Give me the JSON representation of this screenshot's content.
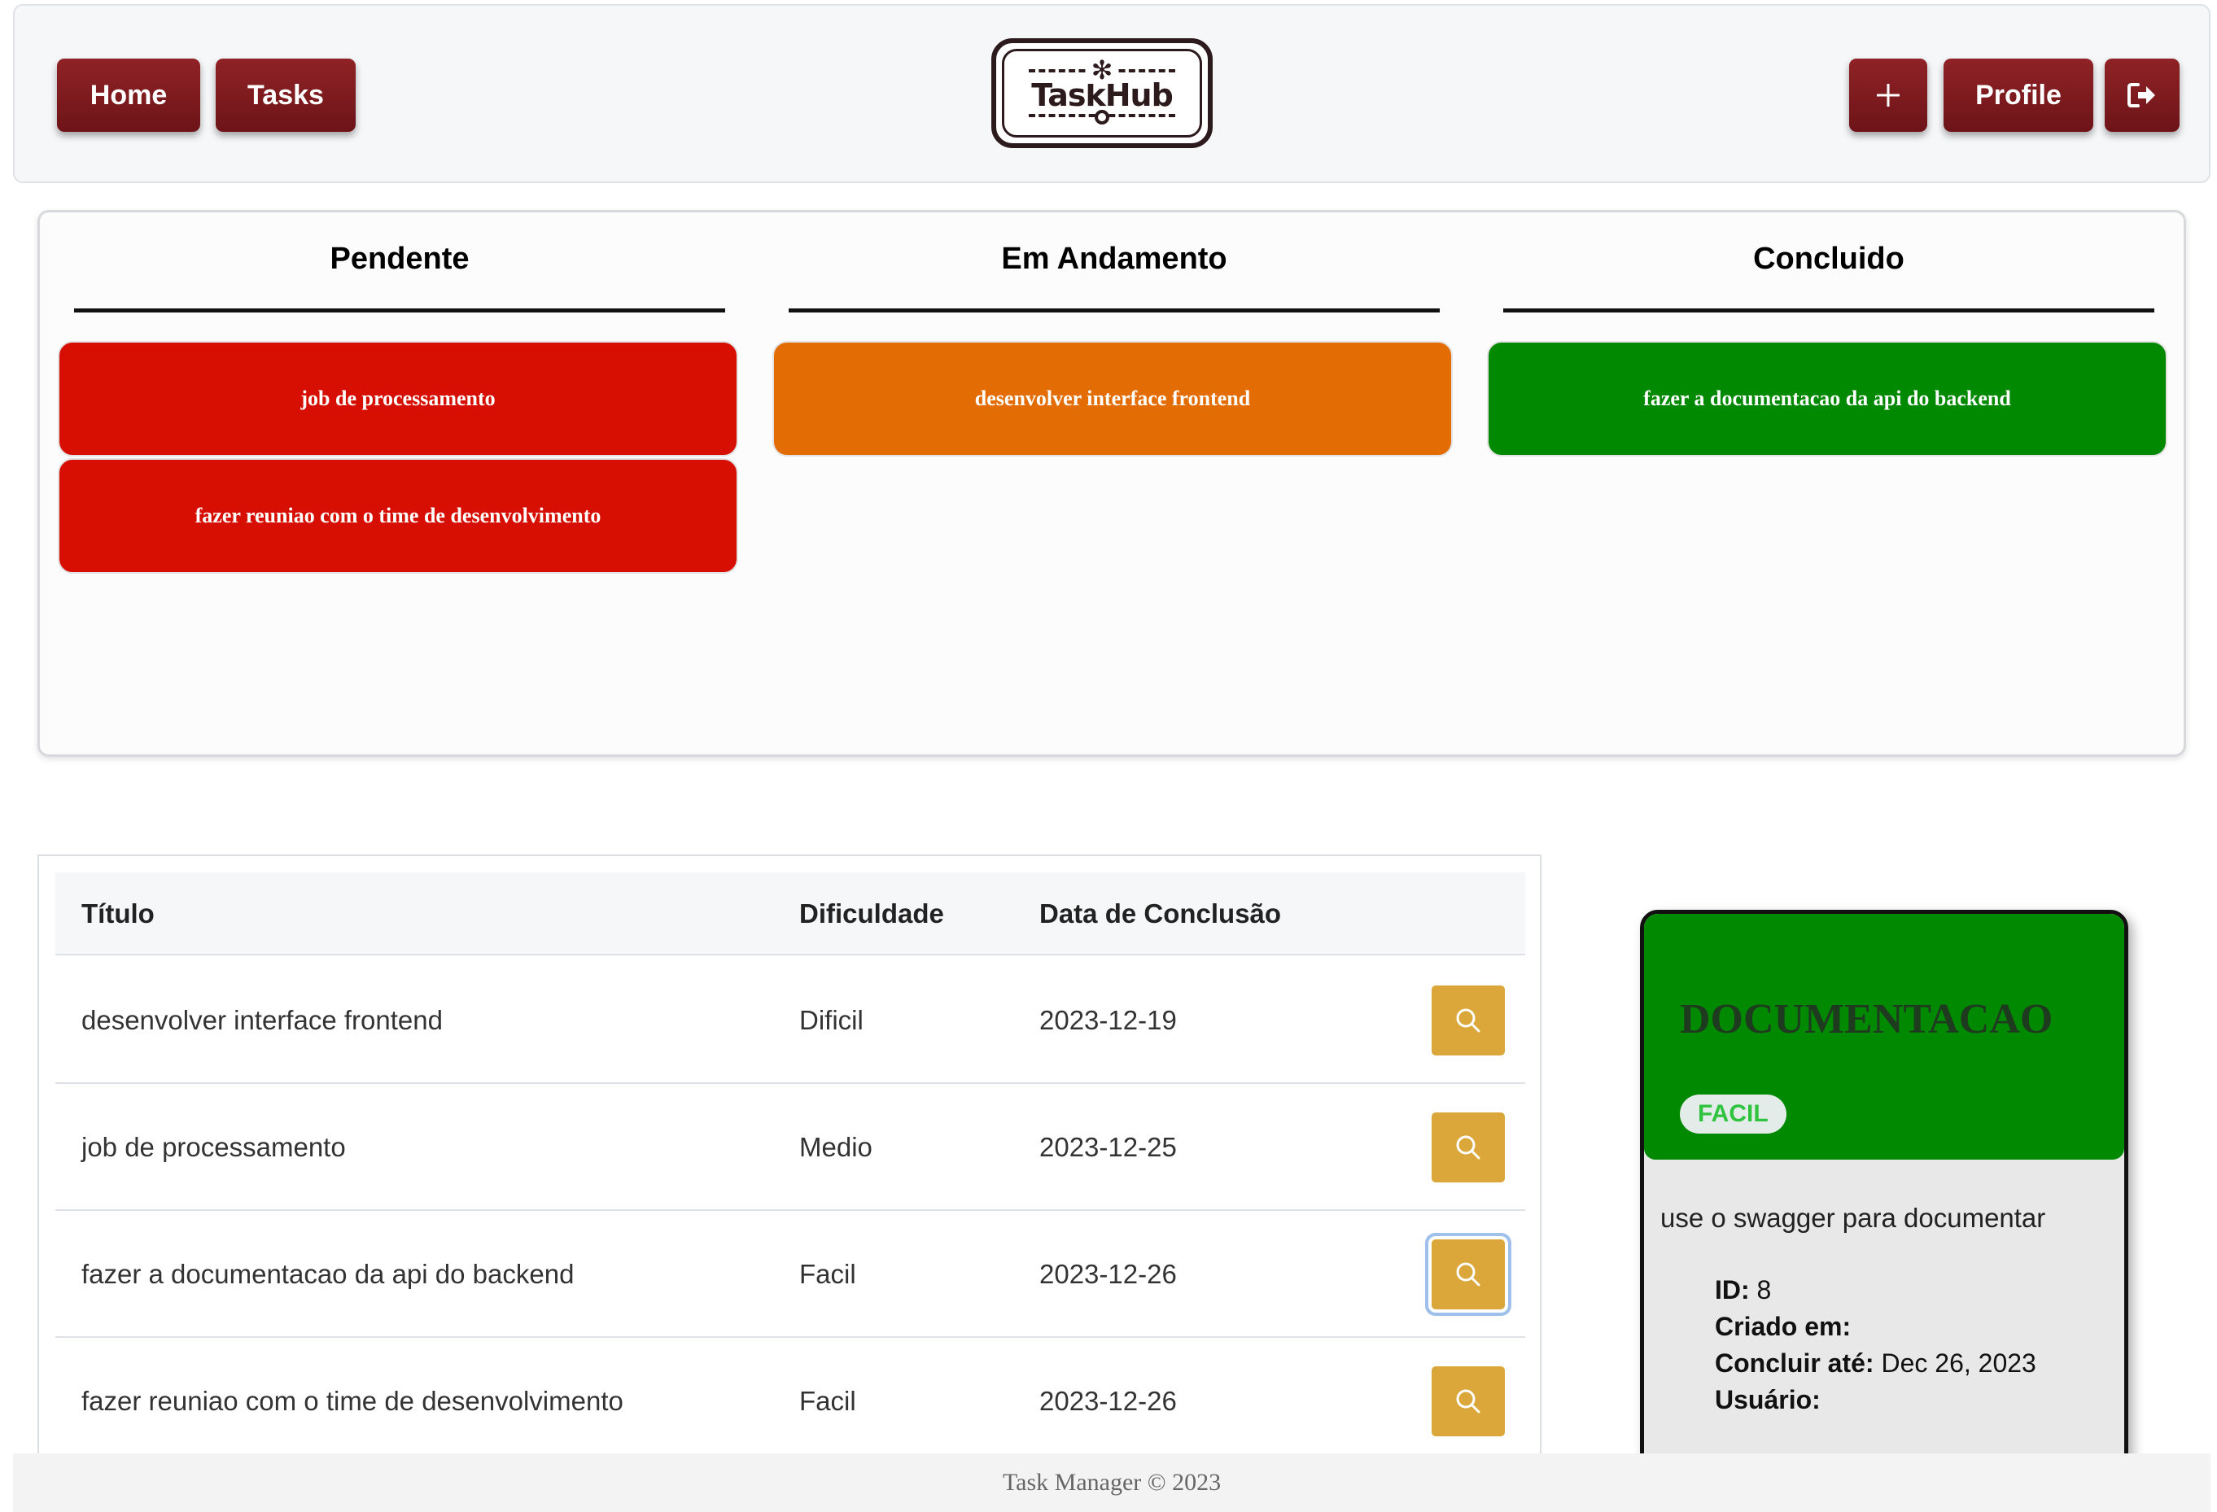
{
  "navbar": {
    "home_label": "Home",
    "tasks_label": "Tasks",
    "logo_text": "TaskHub",
    "add_icon": "plus-icon",
    "profile_label": "Profile",
    "logout_icon": "sign-out-icon",
    "button_color": "#7f1b1f"
  },
  "board": {
    "columns": [
      {
        "title": "Pendente",
        "cards": [
          "job de processamento",
          "fazer reuniao com o time de desenvolvimento"
        ],
        "color": "#d70f02"
      },
      {
        "title": "Em Andamento",
        "cards": [
          "desenvolver interface frontend"
        ],
        "color": "#e36c04"
      },
      {
        "title": "Concluido",
        "cards": [
          "fazer a documentacao da api do backend"
        ],
        "color": "#018a01"
      }
    ]
  },
  "table": {
    "headers": [
      "Título",
      "Dificuldade",
      "Data de Conclusão"
    ],
    "rows": [
      {
        "titulo": "desenvolver interface frontend",
        "dificuldade": "Dificil",
        "data": "2023-12-19"
      },
      {
        "titulo": "job de processamento",
        "dificuldade": "Medio",
        "data": "2023-12-25"
      },
      {
        "titulo": "fazer a documentacao da api do backend",
        "dificuldade": "Facil",
        "data": "2023-12-26"
      },
      {
        "titulo": "fazer reuniao com o time de desenvolvimento",
        "dificuldade": "Facil",
        "data": "2023-12-26"
      }
    ],
    "action_icon": "search-icon",
    "action_color": "#dba73a"
  },
  "detail": {
    "title": "DOCUMENTACAO",
    "badge": "FACIL",
    "description": "use o swagger para documentar",
    "id_label": "ID:",
    "id_value": "8",
    "created_label": "Criado em:",
    "created_value": "",
    "due_label": "Concluir até:",
    "due_value": "Dec 26, 2023",
    "user_label": "Usuário:",
    "user_value": "",
    "header_color": "#018a01"
  },
  "footer": {
    "text": "Task Manager © 2023"
  }
}
